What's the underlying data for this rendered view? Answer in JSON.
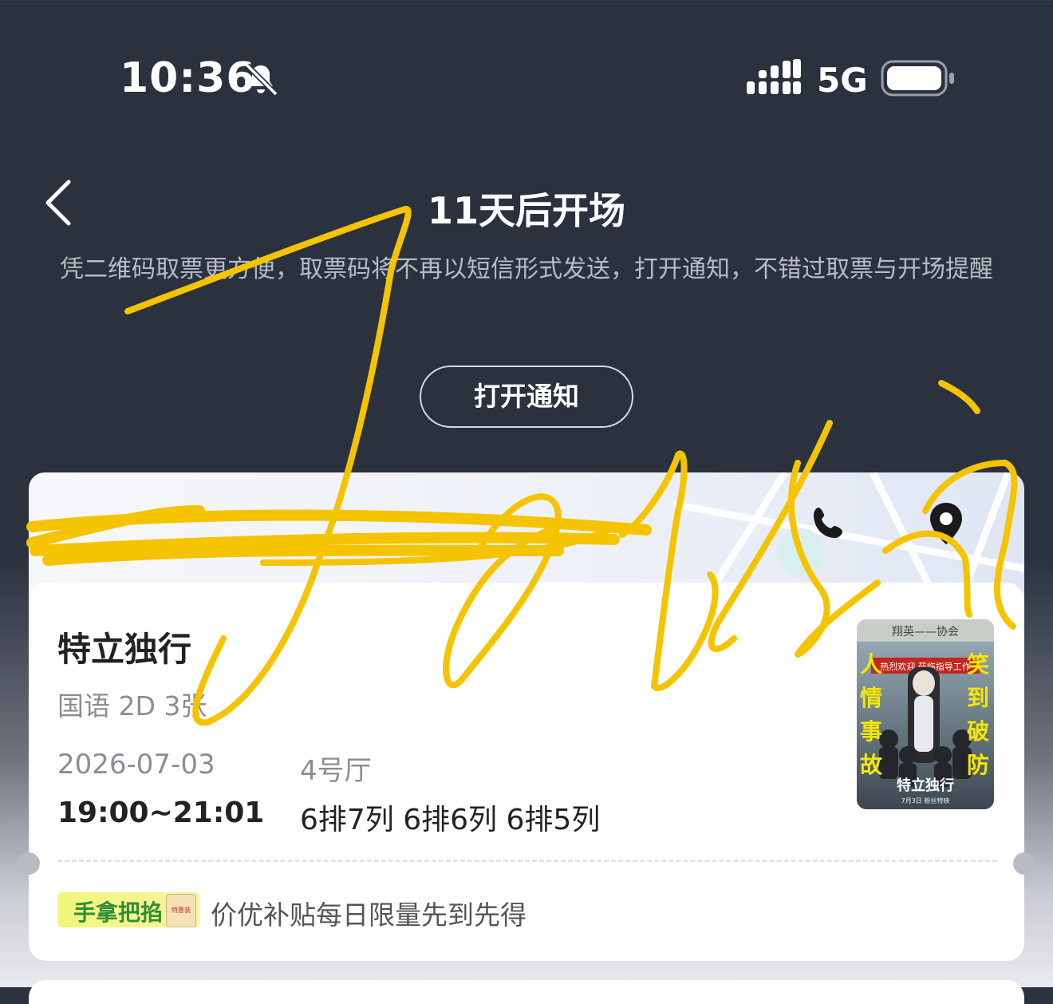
{
  "status_bar": {
    "time": "10:36",
    "network": "5G",
    "icons": [
      "bell-slash-icon",
      "signal-icon",
      "battery-icon"
    ]
  },
  "header": {
    "back_icon": "chevron-left-icon",
    "title": "11天后开场",
    "description": "凭二维码取票更方便，取票码将不再以短信形式发送，打开通知，不错过取票与开场提醒",
    "open_button": "打开通知"
  },
  "cinema": {
    "name": "",
    "icons": [
      "phone-icon",
      "location-pin-icon"
    ]
  },
  "ticket": {
    "movie_title": "特立独行",
    "meta": "国语 2D 3张",
    "date": "2026-07-03",
    "hall": "4号厅",
    "time_range": "19:00~21:01",
    "seats": "6排7列 6排6列 6排5列",
    "poster": {
      "top_sign": "翔英——协会",
      "banner": "热烈欢迎 莅临指导工作",
      "left_text": "人情事故",
      "right_text": "笑到破防",
      "title_logo": "特立独行",
      "release_note": "7月3日 粉丝特映"
    }
  },
  "promo": {
    "badge": "手拿把掐",
    "badge_pkg_text": "特惠装",
    "text": "价优补贴每日限量先到先得"
  },
  "colors": {
    "header_bg": "#2b313d",
    "scribble": "#f5c400",
    "badge_green": "#2f8e3a",
    "badge_yellow": "#f0f67a"
  }
}
